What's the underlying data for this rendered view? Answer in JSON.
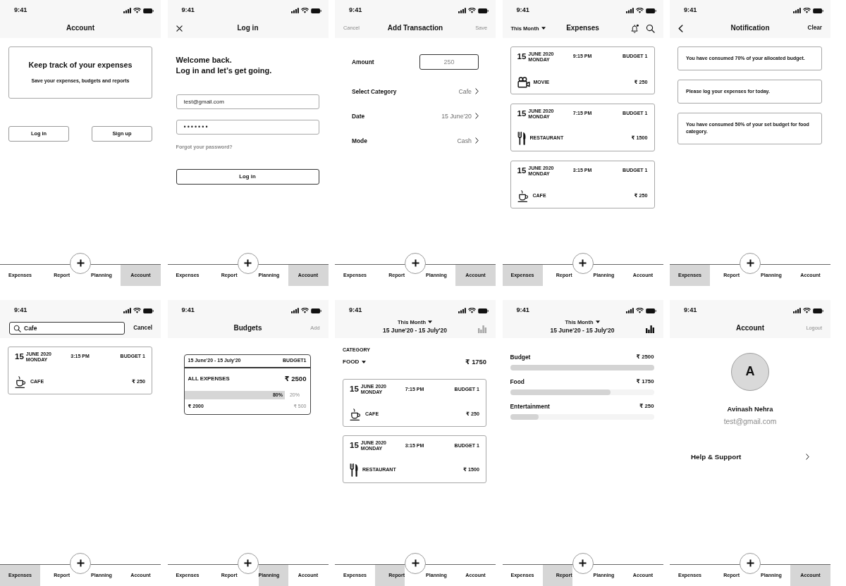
{
  "screens": [
    {
      "kind": "welcome",
      "time": "9:41",
      "header": {
        "title": "Account"
      },
      "hero": {
        "title": "Keep track of your expenses",
        "subtitle": "Save your expenses, budgets and reports"
      },
      "buttons": [
        "Log in",
        "Sign up"
      ],
      "tabs": [
        {
          "label": "Expenses",
          "selected": false
        },
        {
          "label": "Report",
          "selected": false
        },
        {
          "label": "Planning",
          "selected": false
        },
        {
          "label": "Account",
          "selected": true
        }
      ]
    },
    {
      "kind": "login",
      "time": "9:41",
      "header": {
        "title": "Log in"
      },
      "heading": "Welcome back.\nLog in and let’s get going.",
      "email": {
        "value": "test@gmail.com"
      },
      "password": {
        "value": "•••••••"
      },
      "forgot_link": "Forgot your password?",
      "submit": "Log in",
      "tabs": [
        {
          "label": "Expenses",
          "selected": false
        },
        {
          "label": "Report",
          "selected": false
        },
        {
          "label": "Planning",
          "selected": false
        },
        {
          "label": "Account",
          "selected": true
        }
      ]
    },
    {
      "kind": "form",
      "time": "9:41",
      "header": {
        "left": {
          "label": "Cancel",
          "muted": true
        },
        "title": "Add Transaction",
        "right": {
          "label": "Save",
          "muted": true
        }
      },
      "rows": [
        {
          "kind": "input",
          "label": "Amount",
          "placeholder": "250"
        },
        {
          "kind": "picker",
          "label": "Select Category",
          "value": "Cafe"
        },
        {
          "kind": "picker",
          "label": "Date",
          "value": "15 June'20"
        },
        {
          "kind": "picker",
          "label": "Mode",
          "value": "Cash"
        }
      ],
      "tabs": [
        {
          "label": "Expenses",
          "selected": false
        },
        {
          "label": "Report",
          "selected": false
        },
        {
          "label": "Planning",
          "selected": false
        },
        {
          "label": "Account",
          "selected": true
        }
      ]
    },
    {
      "kind": "expenses",
      "time": "9:41",
      "header": {
        "period": "This Month",
        "title": "Expenses"
      },
      "entries": [
        {
          "kind": "movie",
          "day": "15",
          "month": "JUNE 2020",
          "weekday": "MONDAY",
          "time": "9:15 PM",
          "budget": "BUDGET 1",
          "category": "MOVIE",
          "amount": "₹ 250"
        },
        {
          "kind": "restaurant",
          "day": "15",
          "month": "JUNE 2020",
          "weekday": "MONDAY",
          "time": "7:15 PM",
          "budget": "BUDGET 1",
          "category": "RESTAURANT",
          "amount": "₹ 1500"
        },
        {
          "kind": "cafe",
          "day": "15",
          "month": "JUNE 2020",
          "weekday": "MONDAY",
          "time": "3:15 PM",
          "budget": "BUDGET 1",
          "category": "CAFE",
          "amount": "₹ 250"
        }
      ],
      "tabs": [
        {
          "label": "Expenses",
          "selected": true
        },
        {
          "label": "Report",
          "selected": false
        },
        {
          "label": "Planning",
          "selected": false
        },
        {
          "label": "Account",
          "selected": false
        }
      ]
    },
    {
      "kind": "notifications",
      "time": "9:41",
      "header": {
        "title": "Notification",
        "right": {
          "label": "Clear",
          "muted": false
        }
      },
      "notifications": [
        "You have consumed 70% of your allocated budget.",
        "Please log your expenses for today.",
        "You have consumed 50% of your set budget for food category."
      ],
      "tabs": [
        {
          "label": "Expenses",
          "selected": true
        },
        {
          "label": "Report",
          "selected": false
        },
        {
          "label": "Planning",
          "selected": false
        },
        {
          "label": "Account",
          "selected": false
        }
      ]
    },
    {
      "kind": "search",
      "time": "9:41",
      "header": {
        "search": {
          "value": "Cafe"
        },
        "right": {
          "label": "Cancel",
          "muted": false
        }
      },
      "entries": [
        {
          "kind": "cafe",
          "day": "15",
          "month": "JUNE 2020",
          "weekday": "MONDAY",
          "time": "3:15 PM",
          "budget": "BUDGET 1",
          "category": "CAFE",
          "amount": "₹ 250"
        }
      ],
      "tabs": [
        {
          "label": "Expenses",
          "selected": true
        },
        {
          "label": "Report",
          "selected": false
        },
        {
          "label": "Planning",
          "selected": false
        },
        {
          "label": "Account",
          "selected": false
        }
      ]
    },
    {
      "kind": "budgets",
      "time": "9:41",
      "header": {
        "title": "Budgets",
        "right": {
          "label": "Add",
          "muted": true
        }
      },
      "budget": {
        "range": "15 June'20 - 15 July'20",
        "name": "BUDGET1",
        "title": "ALL EXPENSES",
        "total": "₹ 2500",
        "level": 0.8,
        "used_share": "80%",
        "left_share": "20%",
        "used": "₹ 2000",
        "left": "₹ 500"
      },
      "tabs": [
        {
          "label": "Expenses",
          "selected": false
        },
        {
          "label": "Report",
          "selected": false
        },
        {
          "label": "Planning",
          "selected": true
        },
        {
          "label": "Account",
          "selected": false
        }
      ]
    },
    {
      "kind": "report_category",
      "time": "9:41",
      "header": {
        "period": "This Month",
        "range": "15 June'20 - 15 July'20",
        "chart_toggle": {
          "selected": false
        }
      },
      "section": "CATEGORY",
      "category": "FOOD",
      "total": "₹ 1750",
      "entries": [
        {
          "kind": "cafe",
          "day": "15",
          "month": "JUNE 2020",
          "weekday": "MONDAY",
          "time": "7:15 PM",
          "budget": "BUDGET 1",
          "category": "CAFE",
          "amount": "₹ 250"
        },
        {
          "kind": "restaurant",
          "day": "15",
          "month": "JUNE 2020",
          "weekday": "MONDAY",
          "time": "3:15 PM",
          "budget": "BUDGET 1",
          "category": "RESTAURANT",
          "amount": "₹ 1500"
        }
      ],
      "tabs": [
        {
          "label": "Expenses",
          "selected": false
        },
        {
          "label": "Report",
          "selected": true
        },
        {
          "label": "Planning",
          "selected": false
        },
        {
          "label": "Account",
          "selected": false
        }
      ]
    },
    {
      "kind": "report_bars",
      "time": "9:41",
      "header": {
        "period": "This Month",
        "range": "15 June'20 - 15 July'20",
        "chart_toggle": {
          "selected": true
        }
      },
      "bars": [
        {
          "label": "Budget",
          "amount": "₹ 2500",
          "level": 1
        },
        {
          "label": "Food",
          "amount": "₹ 1750",
          "level": 0.7
        },
        {
          "label": "Entertainment",
          "amount": "₹ 250",
          "level": 0.2
        }
      ],
      "tabs": [
        {
          "label": "Expenses",
          "selected": false
        },
        {
          "label": "Report",
          "selected": true
        },
        {
          "label": "Planning",
          "selected": false
        },
        {
          "label": "Account",
          "selected": false
        }
      ]
    },
    {
      "kind": "profile",
      "time": "9:41",
      "header": {
        "title": "Account",
        "right": {
          "label": "Logout",
          "muted": true
        }
      },
      "avatar_initial": "A",
      "name": "Avinash Nehra",
      "email": "test@gmail.com",
      "links": [
        "Help & Support"
      ],
      "tabs": [
        {
          "label": "Expenses",
          "selected": false
        },
        {
          "label": "Report",
          "selected": false
        },
        {
          "label": "Planning",
          "selected": false
        },
        {
          "label": "Account",
          "selected": true
        }
      ]
    }
  ]
}
